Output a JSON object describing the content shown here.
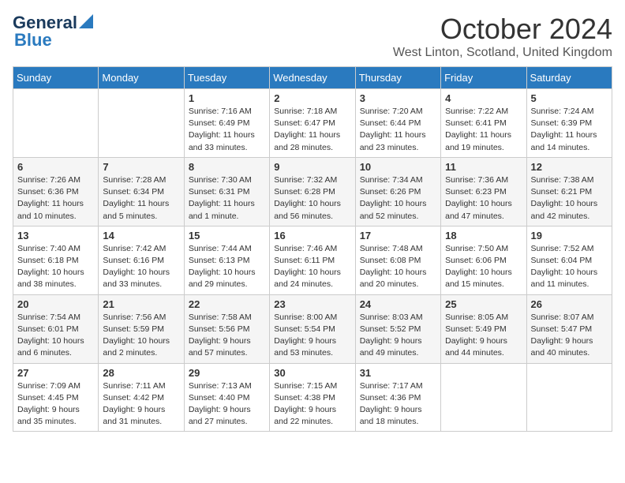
{
  "header": {
    "logo_general": "General",
    "logo_blue": "Blue",
    "title": "October 2024",
    "location": "West Linton, Scotland, United Kingdom"
  },
  "days_of_week": [
    "Sunday",
    "Monday",
    "Tuesday",
    "Wednesday",
    "Thursday",
    "Friday",
    "Saturday"
  ],
  "weeks": [
    [
      {
        "day": "",
        "info": ""
      },
      {
        "day": "",
        "info": ""
      },
      {
        "day": "1",
        "info": "Sunrise: 7:16 AM\nSunset: 6:49 PM\nDaylight: 11 hours\nand 33 minutes."
      },
      {
        "day": "2",
        "info": "Sunrise: 7:18 AM\nSunset: 6:47 PM\nDaylight: 11 hours\nand 28 minutes."
      },
      {
        "day": "3",
        "info": "Sunrise: 7:20 AM\nSunset: 6:44 PM\nDaylight: 11 hours\nand 23 minutes."
      },
      {
        "day": "4",
        "info": "Sunrise: 7:22 AM\nSunset: 6:41 PM\nDaylight: 11 hours\nand 19 minutes."
      },
      {
        "day": "5",
        "info": "Sunrise: 7:24 AM\nSunset: 6:39 PM\nDaylight: 11 hours\nand 14 minutes."
      }
    ],
    [
      {
        "day": "6",
        "info": "Sunrise: 7:26 AM\nSunset: 6:36 PM\nDaylight: 11 hours\nand 10 minutes."
      },
      {
        "day": "7",
        "info": "Sunrise: 7:28 AM\nSunset: 6:34 PM\nDaylight: 11 hours\nand 5 minutes."
      },
      {
        "day": "8",
        "info": "Sunrise: 7:30 AM\nSunset: 6:31 PM\nDaylight: 11 hours\nand 1 minute."
      },
      {
        "day": "9",
        "info": "Sunrise: 7:32 AM\nSunset: 6:28 PM\nDaylight: 10 hours\nand 56 minutes."
      },
      {
        "day": "10",
        "info": "Sunrise: 7:34 AM\nSunset: 6:26 PM\nDaylight: 10 hours\nand 52 minutes."
      },
      {
        "day": "11",
        "info": "Sunrise: 7:36 AM\nSunset: 6:23 PM\nDaylight: 10 hours\nand 47 minutes."
      },
      {
        "day": "12",
        "info": "Sunrise: 7:38 AM\nSunset: 6:21 PM\nDaylight: 10 hours\nand 42 minutes."
      }
    ],
    [
      {
        "day": "13",
        "info": "Sunrise: 7:40 AM\nSunset: 6:18 PM\nDaylight: 10 hours\nand 38 minutes."
      },
      {
        "day": "14",
        "info": "Sunrise: 7:42 AM\nSunset: 6:16 PM\nDaylight: 10 hours\nand 33 minutes."
      },
      {
        "day": "15",
        "info": "Sunrise: 7:44 AM\nSunset: 6:13 PM\nDaylight: 10 hours\nand 29 minutes."
      },
      {
        "day": "16",
        "info": "Sunrise: 7:46 AM\nSunset: 6:11 PM\nDaylight: 10 hours\nand 24 minutes."
      },
      {
        "day": "17",
        "info": "Sunrise: 7:48 AM\nSunset: 6:08 PM\nDaylight: 10 hours\nand 20 minutes."
      },
      {
        "day": "18",
        "info": "Sunrise: 7:50 AM\nSunset: 6:06 PM\nDaylight: 10 hours\nand 15 minutes."
      },
      {
        "day": "19",
        "info": "Sunrise: 7:52 AM\nSunset: 6:04 PM\nDaylight: 10 hours\nand 11 minutes."
      }
    ],
    [
      {
        "day": "20",
        "info": "Sunrise: 7:54 AM\nSunset: 6:01 PM\nDaylight: 10 hours\nand 6 minutes."
      },
      {
        "day": "21",
        "info": "Sunrise: 7:56 AM\nSunset: 5:59 PM\nDaylight: 10 hours\nand 2 minutes."
      },
      {
        "day": "22",
        "info": "Sunrise: 7:58 AM\nSunset: 5:56 PM\nDaylight: 9 hours\nand 57 minutes."
      },
      {
        "day": "23",
        "info": "Sunrise: 8:00 AM\nSunset: 5:54 PM\nDaylight: 9 hours\nand 53 minutes."
      },
      {
        "day": "24",
        "info": "Sunrise: 8:03 AM\nSunset: 5:52 PM\nDaylight: 9 hours\nand 49 minutes."
      },
      {
        "day": "25",
        "info": "Sunrise: 8:05 AM\nSunset: 5:49 PM\nDaylight: 9 hours\nand 44 minutes."
      },
      {
        "day": "26",
        "info": "Sunrise: 8:07 AM\nSunset: 5:47 PM\nDaylight: 9 hours\nand 40 minutes."
      }
    ],
    [
      {
        "day": "27",
        "info": "Sunrise: 7:09 AM\nSunset: 4:45 PM\nDaylight: 9 hours\nand 35 minutes."
      },
      {
        "day": "28",
        "info": "Sunrise: 7:11 AM\nSunset: 4:42 PM\nDaylight: 9 hours\nand 31 minutes."
      },
      {
        "day": "29",
        "info": "Sunrise: 7:13 AM\nSunset: 4:40 PM\nDaylight: 9 hours\nand 27 minutes."
      },
      {
        "day": "30",
        "info": "Sunrise: 7:15 AM\nSunset: 4:38 PM\nDaylight: 9 hours\nand 22 minutes."
      },
      {
        "day": "31",
        "info": "Sunrise: 7:17 AM\nSunset: 4:36 PM\nDaylight: 9 hours\nand 18 minutes."
      },
      {
        "day": "",
        "info": ""
      },
      {
        "day": "",
        "info": ""
      }
    ]
  ]
}
